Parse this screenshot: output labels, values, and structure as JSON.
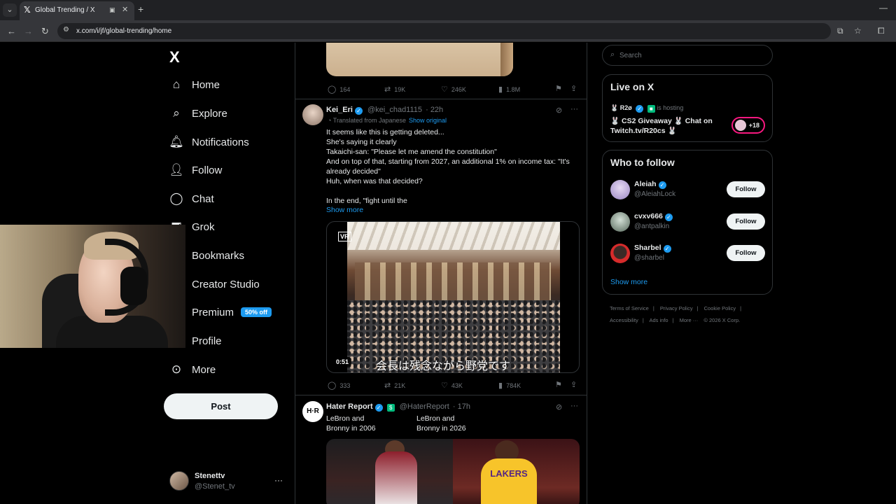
{
  "browser": {
    "tab_title": "Global Trending / X",
    "url": "x.com/i/jf/global-trending/home"
  },
  "nav": {
    "logo": "X",
    "items": [
      {
        "label": "Home",
        "icon": "home-icon"
      },
      {
        "label": "Explore",
        "icon": "search-icon"
      },
      {
        "label": "Notifications",
        "icon": "bell-icon"
      },
      {
        "label": "Follow",
        "icon": "person-add-icon"
      },
      {
        "label": "Chat",
        "icon": "chat-bubble-icon"
      },
      {
        "label": "Grok",
        "icon": "grok-icon"
      },
      {
        "label": "Bookmarks",
        "icon": "bookmark-icon"
      },
      {
        "label": "Creator Studio",
        "icon": "creator-studio-icon"
      },
      {
        "label": "Premium",
        "icon": "premium-icon",
        "badge": "50% off"
      },
      {
        "label": "Profile",
        "icon": "person-icon"
      },
      {
        "label": "More",
        "icon": "more-circle-icon"
      }
    ],
    "post_button": "Post",
    "account": {
      "name": "Stenettv",
      "handle": "@Stenet_tv"
    }
  },
  "feed": {
    "top_tweet_actions": {
      "replies": "164",
      "reposts": "19K",
      "likes": "246K",
      "views": "1.8M"
    },
    "tweet1": {
      "name": "Kei_Eri",
      "handle": "@kei_chad1115",
      "time": "· 22h",
      "translated": "Translated from Japanese",
      "show_original": "Show original",
      "body": "It seems like this is getting deleted...\nShe's saying it clearly\nTakaichi-san: \"Please let me amend the constitution\"\nAnd on top of that, starting from 2027, an additional 1% on income tax: \"It's already decided\"\nHuh, when was that decided?\n\nIn the end, \"fight until the",
      "show_more": "Show more",
      "video_duration": "0:51",
      "video_subtitle": "会長は残念ながら野党です",
      "actions": {
        "replies": "333",
        "reposts": "21K",
        "likes": "43K",
        "views": "784K"
      }
    },
    "tweet2": {
      "name": "Hater Report",
      "handle": "@HaterReport",
      "time": "· 17h",
      "col1": "LeBron and\nBronny in 2006",
      "col2": "LeBron and\nBronny in 2026"
    }
  },
  "sidebar": {
    "search_placeholder": "Search",
    "live": {
      "title": "Live on X",
      "host": "R2ø",
      "hosting_text": "is hosting",
      "stream_title": "🐰 CS2 Giveaway 🐰 Chat on Twitch.tv/R20cs 🐰",
      "listeners": "+18"
    },
    "who_to_follow": {
      "title": "Who to follow",
      "users": [
        {
          "name": "Aleiah",
          "handle": "@AleiahLock",
          "button": "Follow",
          "avatar_color": "#b9a7d6"
        },
        {
          "name": "cvxv666",
          "handle": "@antpalkin",
          "button": "Follow",
          "avatar_color": "#8a9b8f"
        },
        {
          "name": "Sharbel",
          "handle": "@sharbel",
          "button": "Follow",
          "avatar_color": "#d62b2b"
        }
      ],
      "show_more": "Show more"
    },
    "footer": {
      "links1": [
        "Terms of Service",
        "|",
        "Privacy Policy",
        "|",
        "Cookie Policy",
        "|"
      ],
      "links2": [
        "Accessibility",
        "|",
        "Ads info",
        "|",
        "More ···",
        "© 2026 X Corp."
      ]
    }
  }
}
